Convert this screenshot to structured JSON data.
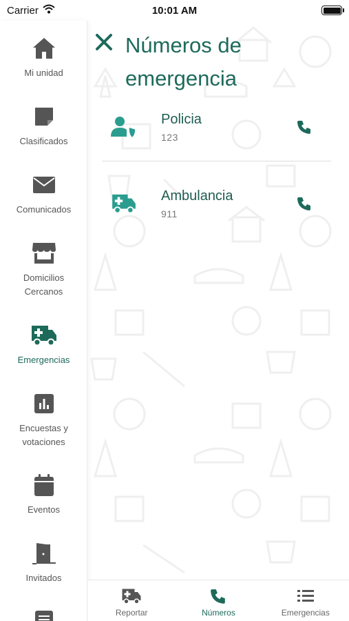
{
  "status_bar": {
    "carrier": "Carrier",
    "time": "10:01 AM"
  },
  "sidebar": {
    "items": [
      {
        "label": "Mi unidad",
        "icon": "home-icon"
      },
      {
        "label": "Clasificados",
        "icon": "note-icon"
      },
      {
        "label": "Comunicados",
        "icon": "mail-icon"
      },
      {
        "label": "Domicilios Cercanos",
        "icon": "store-icon"
      },
      {
        "label": "Emergencias",
        "icon": "ambulance-icon",
        "active": true
      },
      {
        "label": "Encuestas y votaciones",
        "icon": "poll-icon"
      },
      {
        "label": "Eventos",
        "icon": "calendar-icon"
      },
      {
        "label": "Invitados",
        "icon": "door-icon"
      }
    ]
  },
  "main": {
    "title": "Números de emergencia",
    "contacts": [
      {
        "name": "Policia",
        "number": "123",
        "icon": "police-user-shield-icon"
      },
      {
        "name": "Ambulancia",
        "number": "911",
        "icon": "ambulance-icon"
      }
    ]
  },
  "tabbar": {
    "tabs": [
      {
        "label": "Reportar",
        "icon": "ambulance-icon"
      },
      {
        "label": "Números",
        "icon": "phone-icon",
        "active": true
      },
      {
        "label": "Emergencias",
        "icon": "list-icon"
      }
    ]
  },
  "colors": {
    "accent": "#1d6a5b",
    "icon_teal": "#2a9d8f",
    "sidebar_icon": "#555555"
  }
}
